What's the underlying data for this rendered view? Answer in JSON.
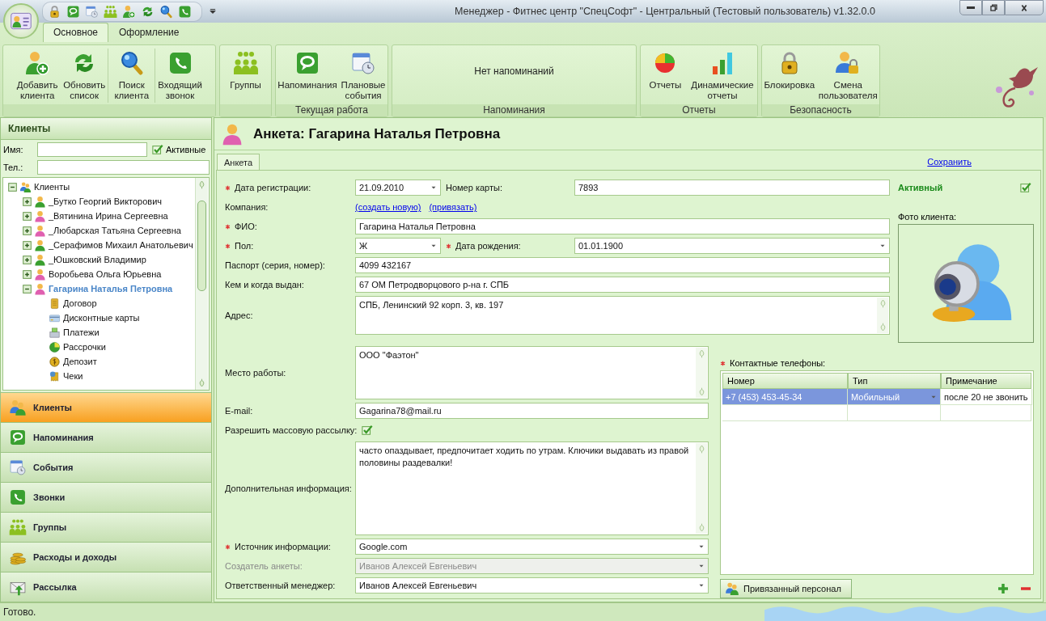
{
  "window": {
    "title": "Менеджер - Фитнес центр \"СпецСофт\" - Центральный (Тестовый пользователь) v1.32.0.0"
  },
  "ribbon": {
    "tabs": [
      {
        "label": "Основное",
        "selected": true
      },
      {
        "label": "Оформление",
        "selected": false
      }
    ],
    "groups": [
      {
        "buttons": [
          "Добавить\nклиента",
          "Обновить\nсписок",
          "Поиск\nклиента",
          "Входящий\nзвонок"
        ]
      },
      {
        "buttons": [
          "Группы"
        ]
      },
      {
        "label": "Текущая работа",
        "buttons": [
          "Напоминания",
          "Плановые\nсобытия"
        ]
      },
      {
        "label": "Напоминания",
        "message": "Нет напоминаний"
      },
      {
        "label": "Отчеты",
        "buttons": [
          "Отчеты",
          "Динамические\nотчеты"
        ]
      },
      {
        "label": "Безопасность",
        "buttons": [
          "Блокировка",
          "Смена\nпользователя"
        ]
      }
    ]
  },
  "clients_panel": {
    "title": "Клиенты",
    "name_label": "Имя:",
    "active_filter": {
      "label": "Активные",
      "checked": true
    },
    "phone_label": "Тел.:",
    "tree": {
      "label": "Клиенты",
      "expanded": true,
      "selected": false,
      "children": [
        {
          "label": "_Бутко Георгий Викторович",
          "color": "#3aa030",
          "expanded": false,
          "selected": false
        },
        {
          "label": "_Вятинина Ирина Сергеевна",
          "color": "#e060b0",
          "expanded": false,
          "selected": false
        },
        {
          "label": "_Любарская Татьяна Сергеевна",
          "color": "#e060b0",
          "expanded": false,
          "selected": false
        },
        {
          "label": "_Серафимов Михаил Анатольевич",
          "color": "#3aa030",
          "expanded": false,
          "selected": false
        },
        {
          "label": "_Юшковский Владимир",
          "color": "#3aa030",
          "expanded": false,
          "selected": false
        },
        {
          "label": "Воробьева Ольга Юрьевна",
          "color": "#e060b0",
          "expanded": false,
          "selected": false
        },
        {
          "label": "Гагарина Наталья Петровна",
          "color": "#e060b0",
          "expanded": true,
          "selected": true,
          "children": [
            {
              "label": "Договор",
              "selected": false
            },
            {
              "label": "Дисконтные карты",
              "selected": false
            },
            {
              "label": "Платежи",
              "selected": false
            },
            {
              "label": "Рассрочки",
              "selected": false
            },
            {
              "label": "Депозит",
              "selected": false
            },
            {
              "label": "Чеки",
              "selected": false
            }
          ]
        }
      ]
    },
    "nav": [
      {
        "label": "Клиенты",
        "selected": true
      },
      {
        "label": "Напоминания",
        "selected": false
      },
      {
        "label": "События",
        "selected": false
      },
      {
        "label": "Звонки",
        "selected": false
      },
      {
        "label": "Группы",
        "selected": false
      },
      {
        "label": "Расходы и доходы",
        "selected": false
      },
      {
        "label": "Рассылка",
        "selected": false
      }
    ]
  },
  "form": {
    "title": "Анкета: Гагарина Наталья Петровна",
    "tabs": [
      {
        "label": "Анкета",
        "selected": true
      }
    ],
    "save_link": "Сохранить",
    "top_rows": [
      {
        "kind": "combo",
        "label": "Дата регистрации:",
        "required": true,
        "value": "21.09.2010",
        "second": {
          "kind": "text",
          "label": "Номер карты:",
          "value": "7893"
        }
      },
      {
        "kind": "links",
        "label": "Компания:",
        "links": [
          "(создать новую)",
          "(привязать)"
        ]
      },
      {
        "kind": "text",
        "label": "ФИО:",
        "required": true,
        "value": "Гагарина Наталья Петровна"
      },
      {
        "kind": "combo",
        "label": "Пол:",
        "required": true,
        "value": "Ж",
        "second": {
          "kind": "combo",
          "label": "Дата рождения:",
          "required": true,
          "value": "01.01.1900"
        }
      },
      {
        "kind": "text",
        "label": "Паспорт (серия, номер):",
        "value": "4099 432167"
      },
      {
        "kind": "text",
        "label": "Кем и когда выдан:",
        "value": "67 ОМ Петродворцового р-на г. СПБ"
      },
      {
        "kind": "textarea",
        "label": "Адрес:",
        "value": "СПБ, Ленинский 92 корп. 3, кв. 197"
      }
    ],
    "bottom_rows": [
      {
        "kind": "textarea",
        "label": "Место работы:",
        "value": "ООО \"Фаэтон\""
      },
      {
        "kind": "text",
        "label": "E-mail:",
        "value": "Gagarina78@mail.ru"
      },
      {
        "kind": "checkbox",
        "label": "Разрешить массовую рассылку:",
        "checked": true
      },
      {
        "kind": "textarea",
        "label": "Дополнительная информация:",
        "value": "часто опаздывает, предпочитает ходить по утрам. Ключики выдавать из правой половины раздевалки!"
      },
      {
        "kind": "combo",
        "label": "Источник информации:",
        "required": true,
        "value": "Google.com",
        "disabled": false
      },
      {
        "kind": "combo",
        "label": "Создатель анкеты:",
        "value": "Иванов Алексей Евгеньевич",
        "disabled": true
      },
      {
        "kind": "combo",
        "label": "Ответственный менеджер:",
        "value": "Иванов Алексей Евгеньевич",
        "disabled": false
      }
    ],
    "status": {
      "label": "Активный",
      "checked": true
    },
    "photo_label": "Фото клиента:",
    "phones": {
      "label": "Контактные телефоны:",
      "required": true,
      "columns": [
        "Номер",
        "Тип",
        "Примечание"
      ],
      "rows": [
        {
          "cells": [
            "+7 (453) 453-45-34",
            "Мобильный",
            "после 20 не звонить"
          ],
          "selected": true
        }
      ]
    },
    "staff_button": "Привязанный персонал"
  },
  "status_bar": "Готово."
}
